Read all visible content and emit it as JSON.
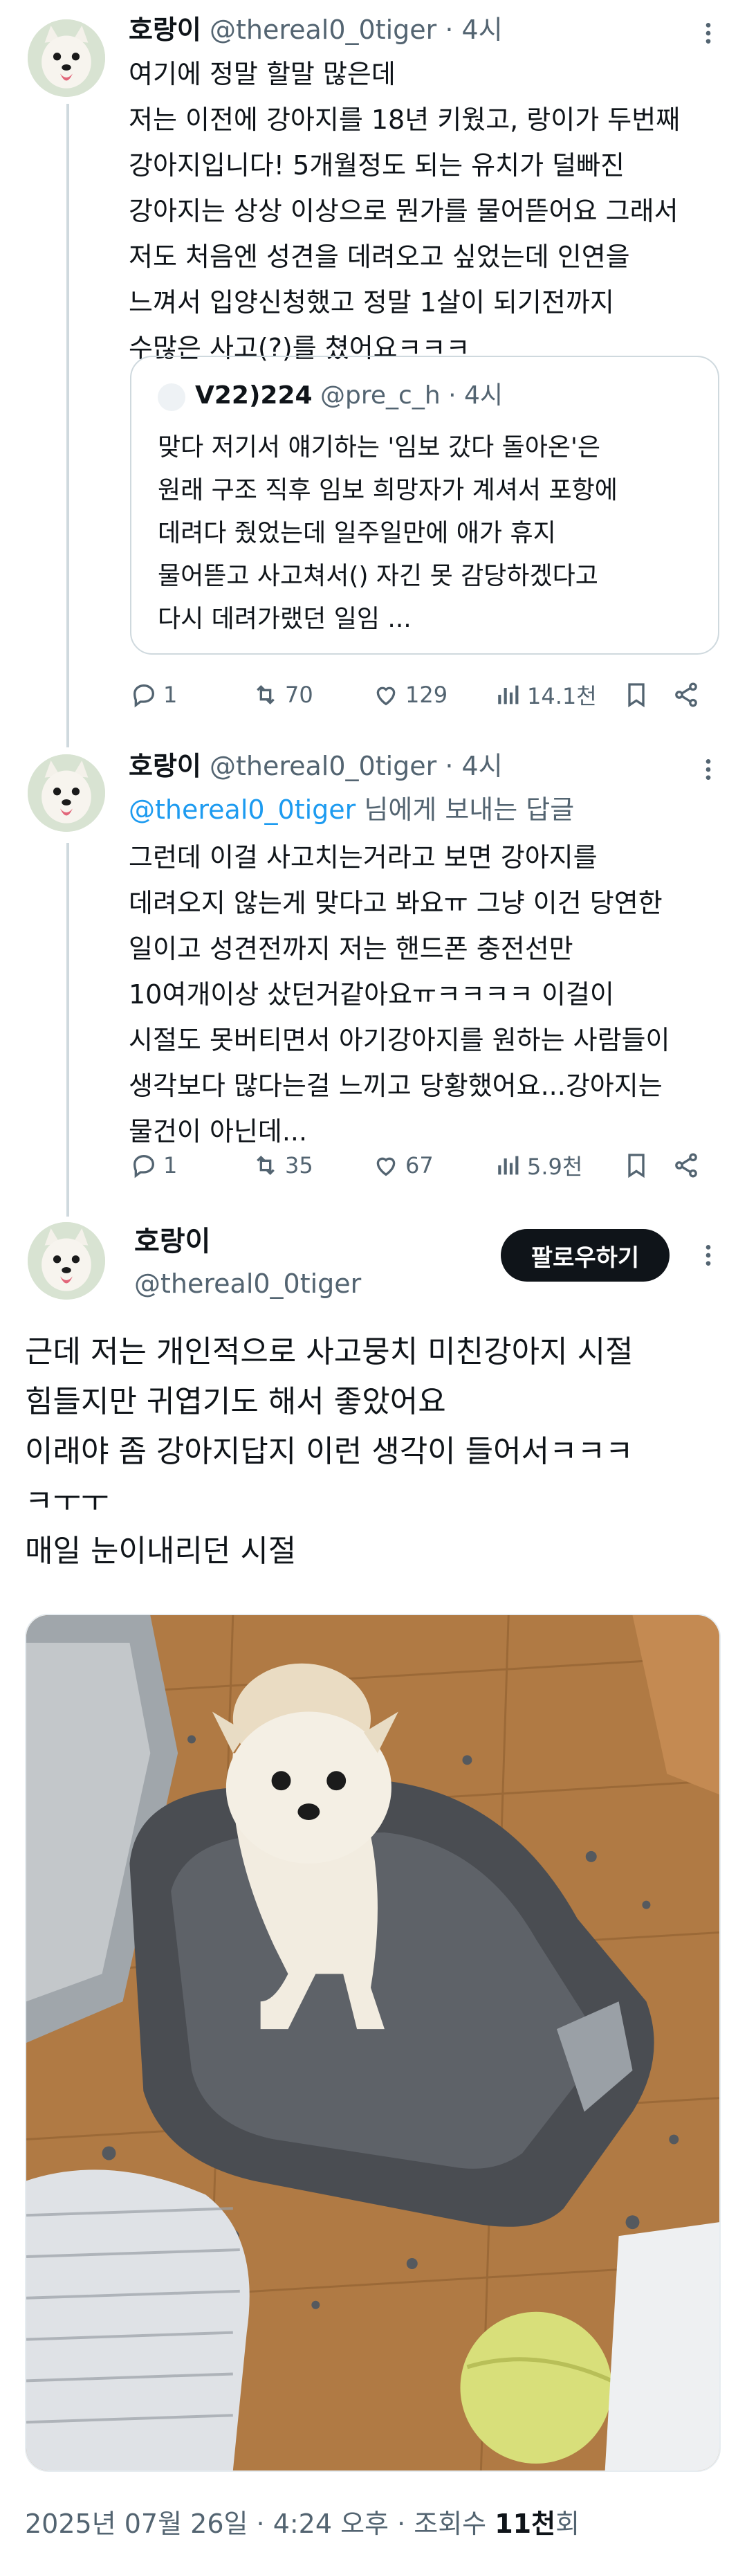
{
  "posts": [
    {
      "name": "호랑이",
      "handle": "@thereal0_0tiger",
      "time": "· 4시",
      "text": "여기에 정말 할말 많은데\n저는 이전에 강아지를 18년 키웠고, 랑이가 두번째\n강아지입니다! 5개월정도 되는 유치가 덜빠진\n강아지는 상상 이상으로 뭔가를 물어뜯어요 그래서\n저도 처음엔 성견을 데려오고 싶었는데 인연을\n느껴서 입양신청했고 정말 1살이 되기전까지\n수많은 사고(?)를 쳤어요ㅋㅋㅋ",
      "quote": {
        "name": "V22)224",
        "handle": "@pre_c_h",
        "time": "· 4시",
        "text": "맞다 저기서 얘기하는 '임보 갔다 돌아온'은\n원래 구조 직후 임보 희망자가 계셔서 포항에\n데려다 줬었는데 일주일만에 애가 휴지\n물어뜯고 사고쳐서() 자긴 못 감당하겠다고\n다시 데려가랬던 일임 ..."
      },
      "actions": {
        "replies": "1",
        "reposts": "70",
        "likes": "129",
        "views": "14.1천"
      }
    },
    {
      "name": "호랑이",
      "handle": "@thereal0_0tiger",
      "time": "· 4시",
      "reply_mention": "@thereal0_0tiger",
      "reply_suffix": " 님에게 보내는 답글",
      "text": "그런데 이걸 사고치는거라고 보면 강아지를\n데려오지 않는게 맞다고 봐요ㅠ 그냥 이건 당연한\n일이고 성견전까지 저는 핸드폰 충전선만\n10여개이상 샀던거같아요ㅠㅋㅋㅋㅋ 이걸이\n시절도 못버티면서 아기강아지를 원하는 사람들이\n생각보다 많다는걸 느끼고 당황했어요...강아지는\n물건이 아닌데...",
      "actions": {
        "replies": "1",
        "reposts": "35",
        "likes": "67",
        "views": "5.9천"
      }
    }
  ],
  "main_post": {
    "name": "호랑이",
    "handle": "@thereal0_0tiger",
    "follow_label": "팔로우하기",
    "text": "근데 저는 개인적으로 사고뭉치 미친강아지 시절\n힘들지만 귀엽기도 해서 좋았어요\n이래야 좀 강아지답지 이런 생각이 들어서ㅋㅋㅋ\nㅋㅜㅜ\n매일 눈이내리던 시절",
    "timestamp": "2025년 07월 26일 · 4:24 오후 · 조회수 ",
    "views_count": "11천",
    "views_suffix": "회"
  },
  "colors": {
    "text": "#0f1419",
    "muted": "#536471",
    "link": "#1d9bf0",
    "border": "#cfd9de",
    "button": "#0f1419"
  },
  "icons": [
    "more-icon",
    "reply-icon",
    "repost-icon",
    "like-icon",
    "views-icon",
    "bookmark-icon",
    "share-icon"
  ]
}
